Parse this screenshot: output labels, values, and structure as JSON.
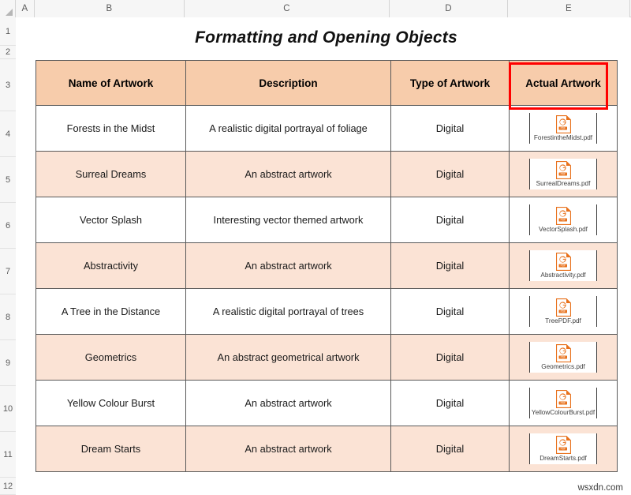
{
  "spreadsheet": {
    "column_headers": [
      "A",
      "B",
      "C",
      "D",
      "E"
    ],
    "row_headers": [
      "1",
      "2",
      "3",
      "4",
      "5",
      "6",
      "7",
      "8",
      "9",
      "10",
      "11",
      "12"
    ],
    "watermark": "wsxdn.com"
  },
  "title": "Formatting and Opening Objects",
  "table": {
    "headers": [
      "Name of Artwork",
      "Description",
      "Type of Artwork",
      "Actual Artwork"
    ],
    "rows": [
      {
        "name": "Forests in the Midst",
        "description": "A realistic digital portrayal of  foliage",
        "type": "Digital",
        "file": "ForestintheMidst.pdf",
        "shaded": false,
        "selected": true
      },
      {
        "name": "Surreal Dreams",
        "description": "An abstract artwork",
        "type": "Digital",
        "file": "SurrealDreams.pdf",
        "shaded": true,
        "selected": false
      },
      {
        "name": "Vector Splash",
        "description": "Interesting vector themed artwork",
        "type": "Digital",
        "file": "VectorSplash.pdf",
        "shaded": false,
        "selected": false
      },
      {
        "name": "Abstractivity",
        "description": "An abstract artwork",
        "type": "Digital",
        "file": "Abstractivity.pdf",
        "shaded": true,
        "selected": false
      },
      {
        "name": "A Tree in the Distance",
        "description": "A realistic digital portrayal of trees",
        "type": "Digital",
        "file": "TreePDF.pdf",
        "shaded": false,
        "selected": false
      },
      {
        "name": "Geometrics",
        "description": "An abstract geometrical artwork",
        "type": "Digital",
        "file": "Geometrics.pdf",
        "shaded": true,
        "selected": false
      },
      {
        "name": "Yellow Colour Burst",
        "description": "An abstract artwork",
        "type": "Digital",
        "file": "YellowColourBurst.pdf",
        "shaded": false,
        "selected": false
      },
      {
        "name": "Dream Starts",
        "description": "An abstract artwork",
        "type": "Digital",
        "file": "DreamStarts.pdf",
        "shaded": true,
        "selected": false
      }
    ]
  },
  "colors": {
    "header_fill": "#f7ccab",
    "row_shade": "#fbe3d5",
    "border": "#595959",
    "selection": "#ff0000",
    "pdf_icon": "#e8701a"
  },
  "icons": {
    "pdf": "pdf-file-icon"
  }
}
